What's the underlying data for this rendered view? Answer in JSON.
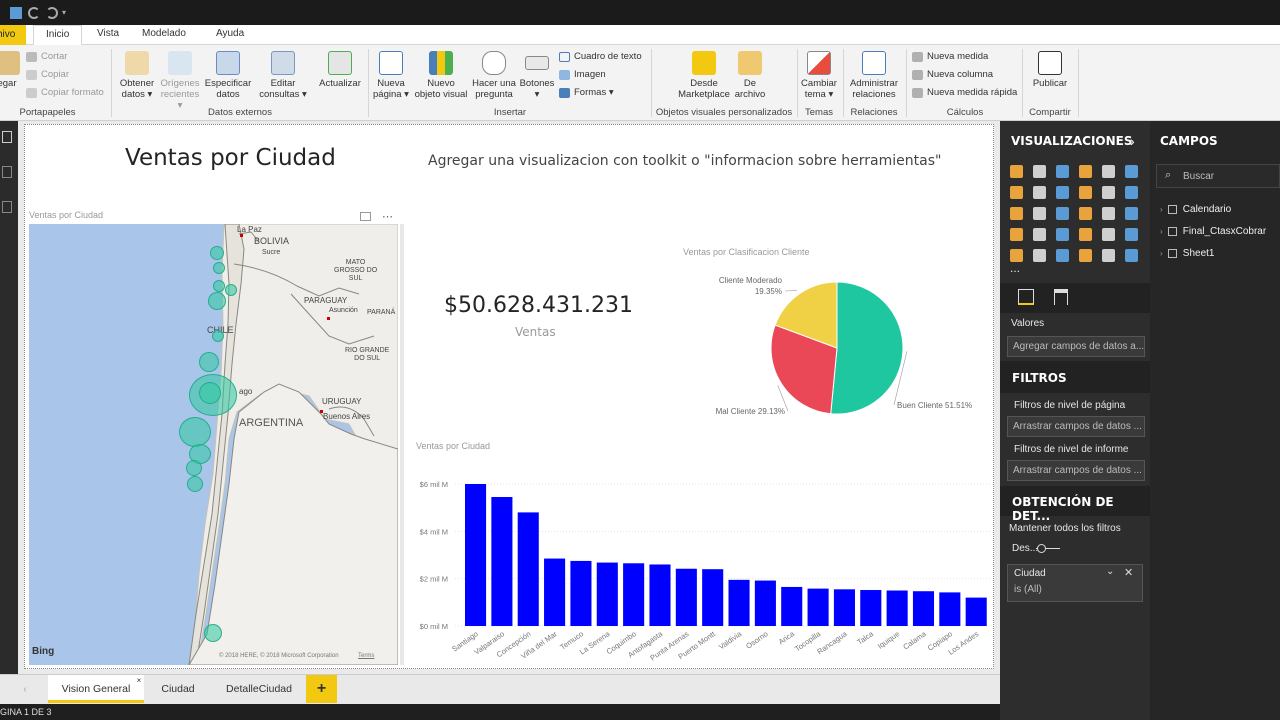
{
  "window": {
    "status_text": "GINA 1 DE 3"
  },
  "menu_tabs": {
    "file": "chivo",
    "home": "Inicio",
    "view": "Vista",
    "modeling": "Modelado",
    "help": "Ayuda"
  },
  "ribbon": {
    "paste": "egar",
    "cut": "Cortar",
    "copy": "Copiar",
    "format_painter": "Copiar formato",
    "clipboard_group": "Portapapeles",
    "get_data": "Obtener",
    "get_data_2": "datos",
    "recent_sources": "Orígenes",
    "recent_sources_2": "recientes",
    "enter_data": "Especificar",
    "enter_data_2": "datos",
    "edit_queries": "Editar",
    "edit_queries_2": "consultas",
    "refresh": "Actualizar",
    "external_data_group": "Datos externos",
    "new_page": "Nueva",
    "new_page_2": "página",
    "new_visual": "Nuevo",
    "new_visual_2": "objeto visual",
    "ask_question": "Hacer una",
    "ask_question_2": "pregunta",
    "buttons": "Botones",
    "textbox": "Cuadro de texto",
    "image": "Imagen",
    "shapes": "Formas",
    "insert_group": "Insertar",
    "marketplace": "Desde",
    "marketplace_2": "Marketplace",
    "from_file": "De",
    "from_file_2": "archivo",
    "custom_visuals_group": "Objetos visuales personalizados",
    "switch_theme": "Cambiar",
    "switch_theme_2": "tema",
    "themes_group": "Temas",
    "manage_rel": "Administrar",
    "manage_rel_2": "relaciones",
    "relations_group": "Relaciones",
    "new_measure": "Nueva medida",
    "new_column": "Nueva columna",
    "quick_measure": "Nueva medida rápida",
    "calculations_group": "Cálculos",
    "publish": "Publicar",
    "share_group": "Compartir"
  },
  "report": {
    "title": "Ventas por Ciudad",
    "subtitle": "Agregar una visualizacion con toolkit o \"informacion sobre herramientas\"",
    "map_title": "Ventas por Ciudad",
    "map_labels": {
      "la_paz": "La Paz",
      "bolivia": "BOLIVIA",
      "sucre": "Sucre",
      "mato_grosso": "MATO",
      "mato_grosso_2": "GROSSO DO",
      "mato_grosso_3": "SUL",
      "paraguay": "PARAGUAY",
      "asuncion": "Asunción",
      "parana": "PARANÁ",
      "chile": "CHILE",
      "rio_grande": "RIO GRANDE",
      "rio_grande_2": "DO SUL",
      "uruguay": "URUGUAY",
      "buenos_aires": "Buenos Aires",
      "argentina": "ARGENTINA",
      "santiago_frag": "ago",
      "bing": "Bing",
      "copyright": "© 2018 HERE, © 2018 Microsoft Corporation",
      "terms": "Terms"
    },
    "kpi_value": "$50.628.431.231",
    "kpi_label": "Ventas"
  },
  "chart_data": [
    {
      "type": "pie",
      "title": "Ventas por Clasificacion Cliente",
      "slices": [
        {
          "label": "Buen Cliente",
          "value": 51.51,
          "text": "Buen Cliente 51.51%",
          "color": "#1fc7a0"
        },
        {
          "label": "Mal Cliente",
          "value": 29.13,
          "text": "Mal Cliente 29.13%",
          "color": "#ea4757"
        },
        {
          "label": "Cliente Moderado",
          "value": 19.35,
          "text": "19.35%",
          "color": "#f0d145"
        }
      ]
    },
    {
      "type": "bar",
      "title": "Ventas por Ciudad",
      "color": "#0000ff",
      "categories": [
        "Santiago",
        "Valparaiso",
        "Concepción",
        "Viña del Mar",
        "Temuco",
        "La Serena",
        "Coquimbo",
        "Antofagasta",
        "Punta Arenas",
        "Puerto Montt",
        "Valdivia",
        "Osorno",
        "Arica",
        "Tocopilla",
        "Rancagua",
        "Talca",
        "Iquique",
        "Calama",
        "Copiapo",
        "Los Andes"
      ],
      "values": [
        6.0,
        5.45,
        4.8,
        2.85,
        2.75,
        2.68,
        2.65,
        2.6,
        2.42,
        2.4,
        1.95,
        1.92,
        1.65,
        1.58,
        1.55,
        1.52,
        1.5,
        1.47,
        1.42,
        1.2
      ],
      "ylim": [
        0,
        6
      ],
      "yticks": [
        "$0 mil M",
        "$2 mil M",
        "$4 mil M",
        "$6 mil M"
      ],
      "ytick_values": [
        0,
        2,
        4,
        6
      ]
    }
  ],
  "page_tabs": [
    "Vision General",
    "Ciudad",
    "DetalleCiudad"
  ],
  "add_tab": "+",
  "viz_pane": {
    "title": "VISUALIZACIONES",
    "values_label": "Valores",
    "values_placeholder": "Agregar campos de datos a...",
    "filters_title": "FILTROS",
    "page_filters": "Filtros de nivel de página",
    "page_filters_drop": "Arrastrar campos de datos ...",
    "report_filters": "Filtros de nivel de informe",
    "report_filters_drop": "Arrastrar campos de datos ...",
    "drill_title": "OBTENCIÓN DE DET...",
    "keep_filters": "Mantener todos los filtros",
    "toggle_label": "Des...",
    "filter_card_field": "Ciudad",
    "filter_card_value": "is (All)",
    "more": "..."
  },
  "fields_pane": {
    "title": "CAMPOS",
    "search_placeholder": "Buscar",
    "tables": [
      "Calendario",
      "Final_CtasxCobrar",
      "Sheet1"
    ]
  }
}
